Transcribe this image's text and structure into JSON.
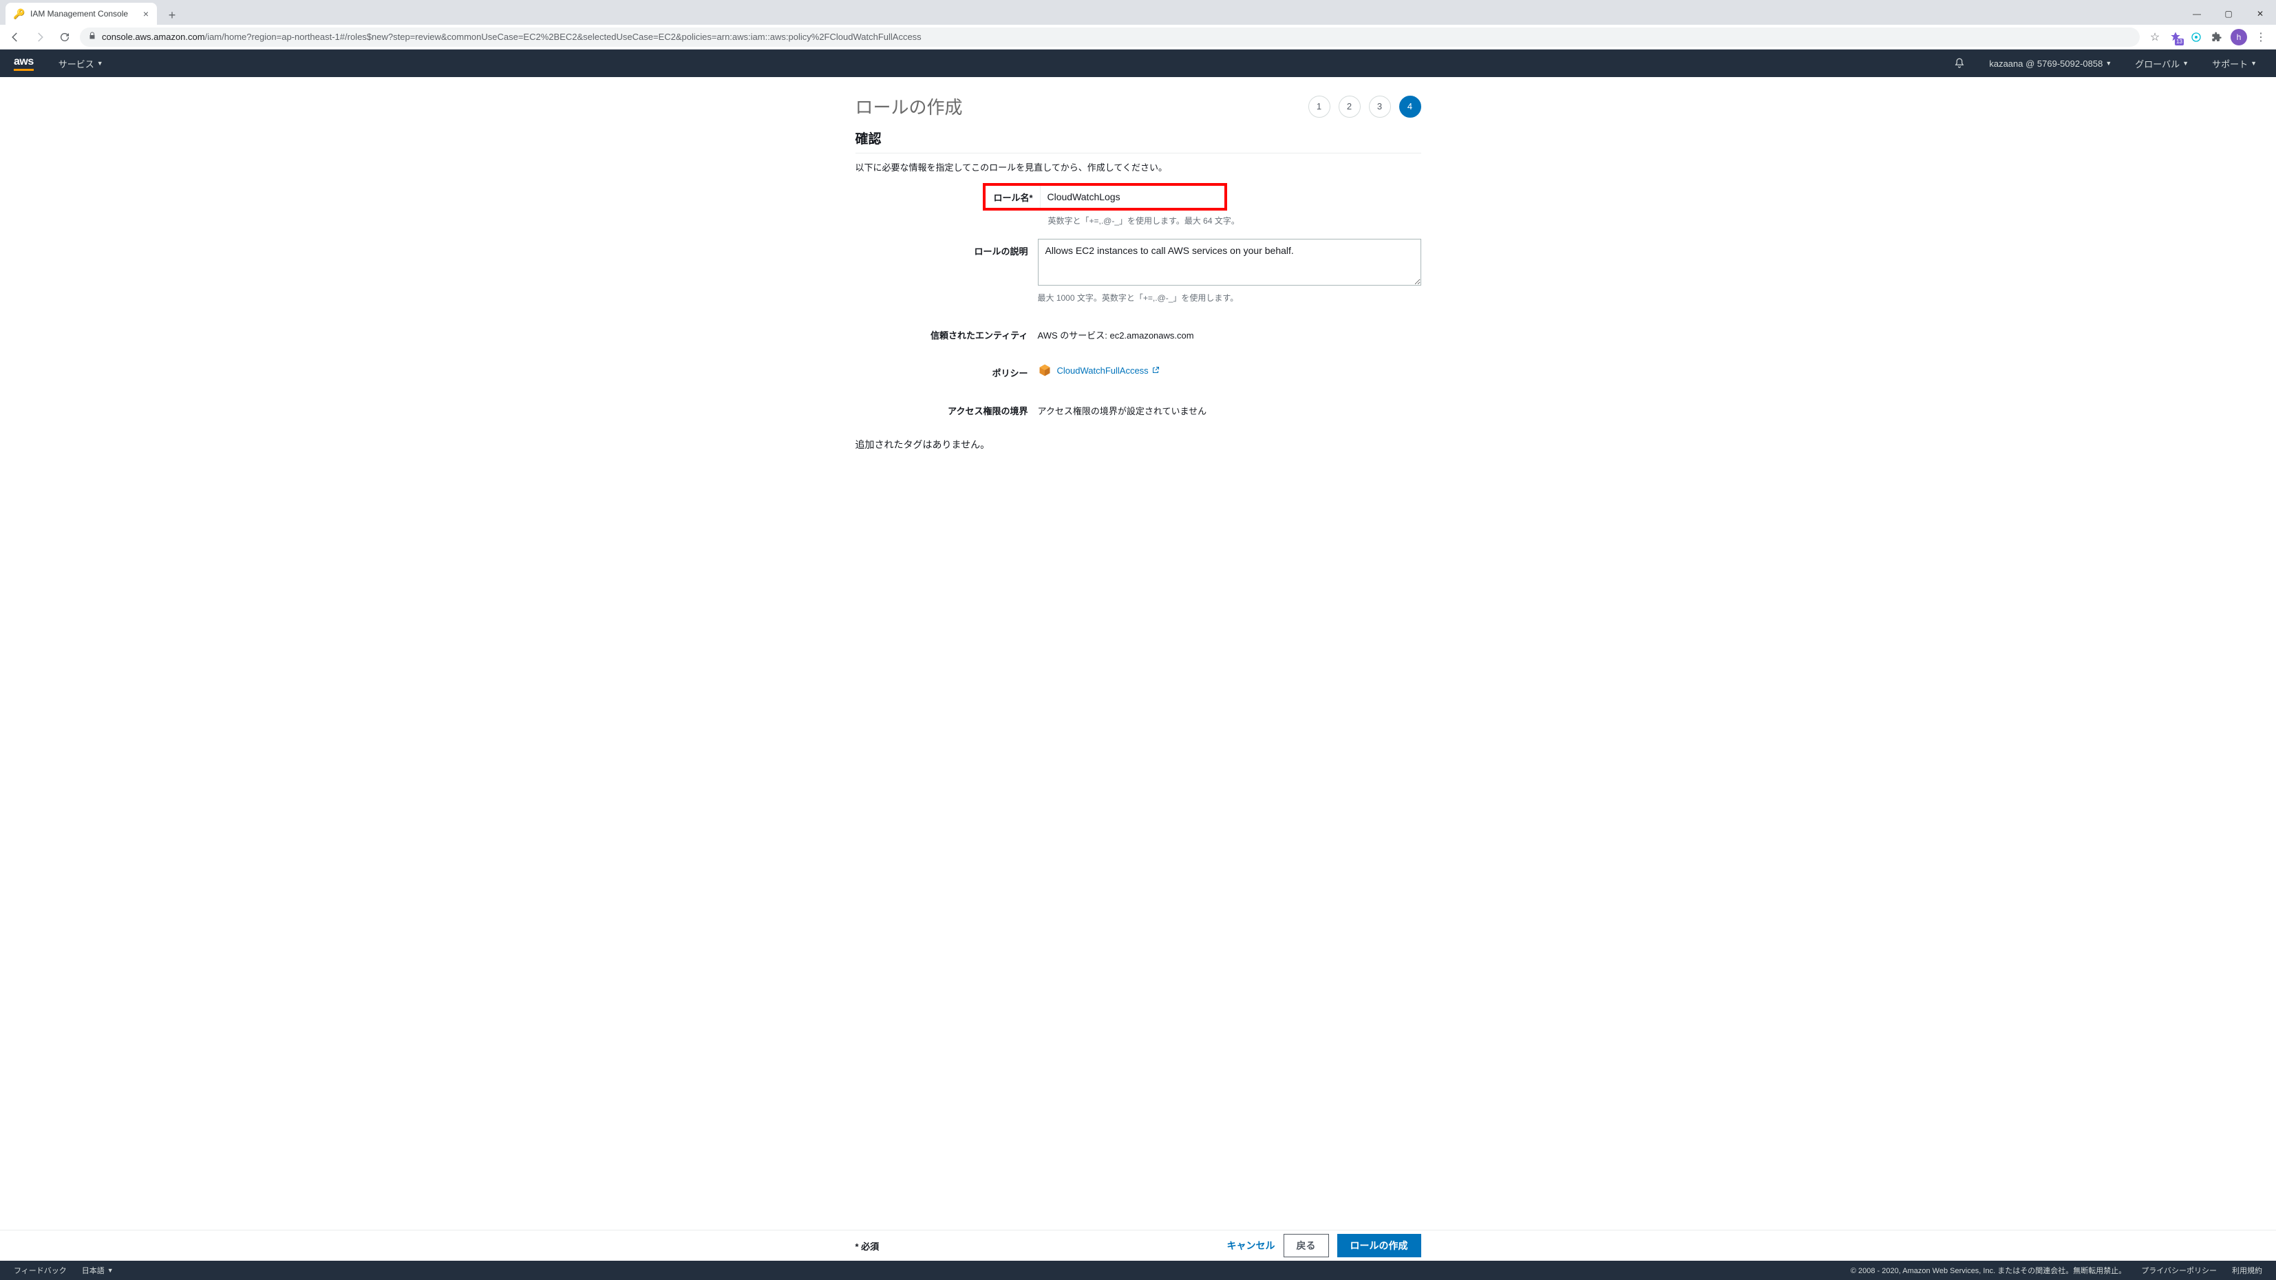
{
  "browser": {
    "tab_title": "IAM Management Console",
    "url_domain": "console.aws.amazon.com",
    "url_path": "/iam/home?region=ap-northeast-1#/roles$new?step=review&commonUseCase=EC2%2BEC2&selectedUseCase=EC2&policies=arn:aws:iam::aws:policy%2FCloudWatchFullAccess",
    "ext_badge": "13",
    "avatar_letter": "h"
  },
  "nav": {
    "logo": "aws",
    "services": "サービス",
    "account": "kazaana @ 5769-5092-0858",
    "region": "グローバル",
    "support": "サポート"
  },
  "page": {
    "title": "ロールの作成",
    "steps": {
      "s1": "1",
      "s2": "2",
      "s3": "3",
      "s4": "4",
      "active": 4
    },
    "section_title": "確認",
    "section_desc": "以下に必要な情報を指定してこのロールを見直してから、作成してください。",
    "role_name_label": "ロール名*",
    "role_name_value": "CloudWatchLogs",
    "role_name_hint": "英数字と「+=,.@-_」を使用します。最大 64 文字。",
    "role_desc_label": "ロールの説明",
    "role_desc_value": "Allows EC2 instances to call AWS services on your behalf.",
    "role_desc_hint": "最大 1000 文字。英数字と「+=,.@-_」を使用します。",
    "trusted_label": "信頼されたエンティティ",
    "trusted_value": "AWS のサービス: ec2.amazonaws.com",
    "policy_label": "ポリシー",
    "policy_link": "CloudWatchFullAccess",
    "boundary_label": "アクセス権限の境界",
    "boundary_value": "アクセス権限の境界が設定されていません",
    "no_tags": "追加されたタグはありません。",
    "required_note": "* 必須",
    "cancel": "キャンセル",
    "back": "戻る",
    "create": "ロールの作成"
  },
  "footer": {
    "feedback": "フィードバック",
    "language": "日本語",
    "copyright": "© 2008 - 2020, Amazon Web Services, Inc. またはその関連会社。無断転用禁止。",
    "privacy": "プライバシーポリシー",
    "terms": "利用規約"
  }
}
